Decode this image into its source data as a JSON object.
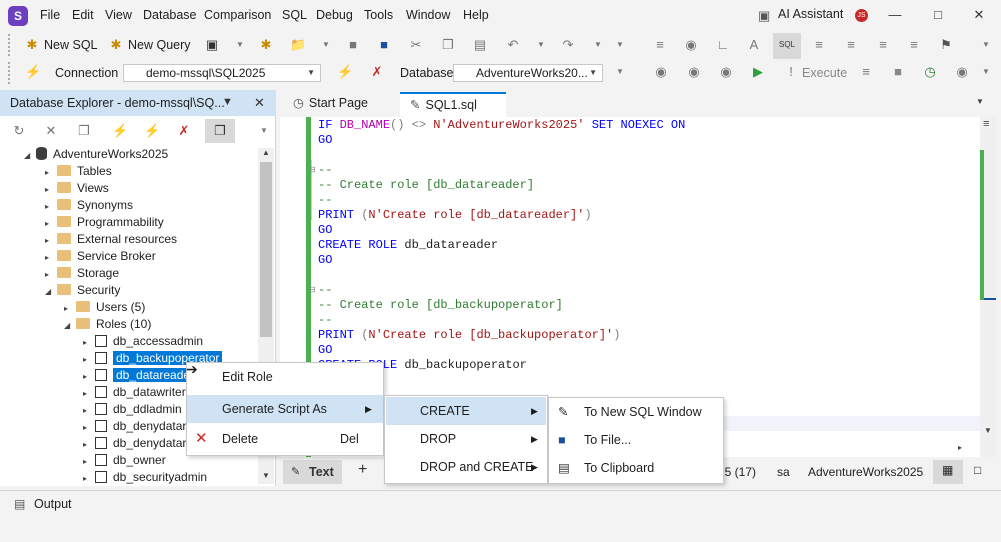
{
  "app": {
    "logo": "S"
  },
  "menu": [
    "File",
    "Edit",
    "View",
    "Database",
    "Comparison",
    "SQL",
    "Debug",
    "Tools",
    "Window",
    "Help"
  ],
  "titlebar": {
    "ai_assistant": "AI Assistant",
    "user_initials": "JS"
  },
  "toolbar1": {
    "new_sql": "New SQL",
    "new_query": "New Query"
  },
  "toolbar2": {
    "connection_label": "Connection",
    "connection_value": "demo-mssql\\SQL2025",
    "database_label": "Database",
    "database_value": "AdventureWorks20...",
    "execute": "Execute"
  },
  "db_explorer": {
    "title": "Database Explorer - demo-mssql\\SQ...",
    "tree": {
      "database": "AdventureWorks2025",
      "folders": [
        "Tables",
        "Views",
        "Synonyms",
        "Programmability",
        "External resources",
        "Service Broker",
        "Storage"
      ],
      "security": "Security",
      "users": "Users (5)",
      "roles": "Roles (10)",
      "role_items": [
        "db_accessadmin",
        "db_backupoperator",
        "db_datareader",
        "db_datawriter",
        "db_ddladmin",
        "db_denydatar",
        "db_denydatar",
        "db_owner",
        "db_securityadmin"
      ]
    }
  },
  "tabs": {
    "start_page": "Start Page",
    "sql1": "SQL1.sql"
  },
  "code_lines": [
    "IF DB_NAME() <> N'AdventureWorks2025' SET NOEXEC ON",
    "GO",
    "",
    "--",
    "-- Create role [db_datareader]",
    "--",
    "PRINT (N'Create role [db_datareader]')",
    "GO",
    "CREATE ROLE db_datareader",
    "GO",
    "",
    "--",
    "-- Create role [db_backupoperator]",
    "--",
    "PRINT (N'Create role [db_backupoperator]')",
    "GO",
    "CREATE ROLE db_backupoperator"
  ],
  "editor_status": {
    "text_tab": "Text",
    "position": "25 (17)",
    "user": "sa",
    "database": "AdventureWorks2025"
  },
  "context_menu": {
    "edit_role": "Edit Role",
    "generate_script_as": "Generate Script As",
    "delete": "Delete",
    "delete_shortcut": "Del"
  },
  "submenu1": {
    "create": "CREATE",
    "drop": "DROP",
    "drop_and_create": "DROP and CREATE"
  },
  "submenu2": {
    "new_sql_window": "To New SQL Window",
    "to_file": "To File...",
    "to_clipboard": "To Clipboard"
  },
  "output": {
    "label": "Output"
  },
  "colors": {
    "selection": "#0078d7",
    "highlight": "#cfe3f5",
    "brand": "#6b3fbf"
  }
}
